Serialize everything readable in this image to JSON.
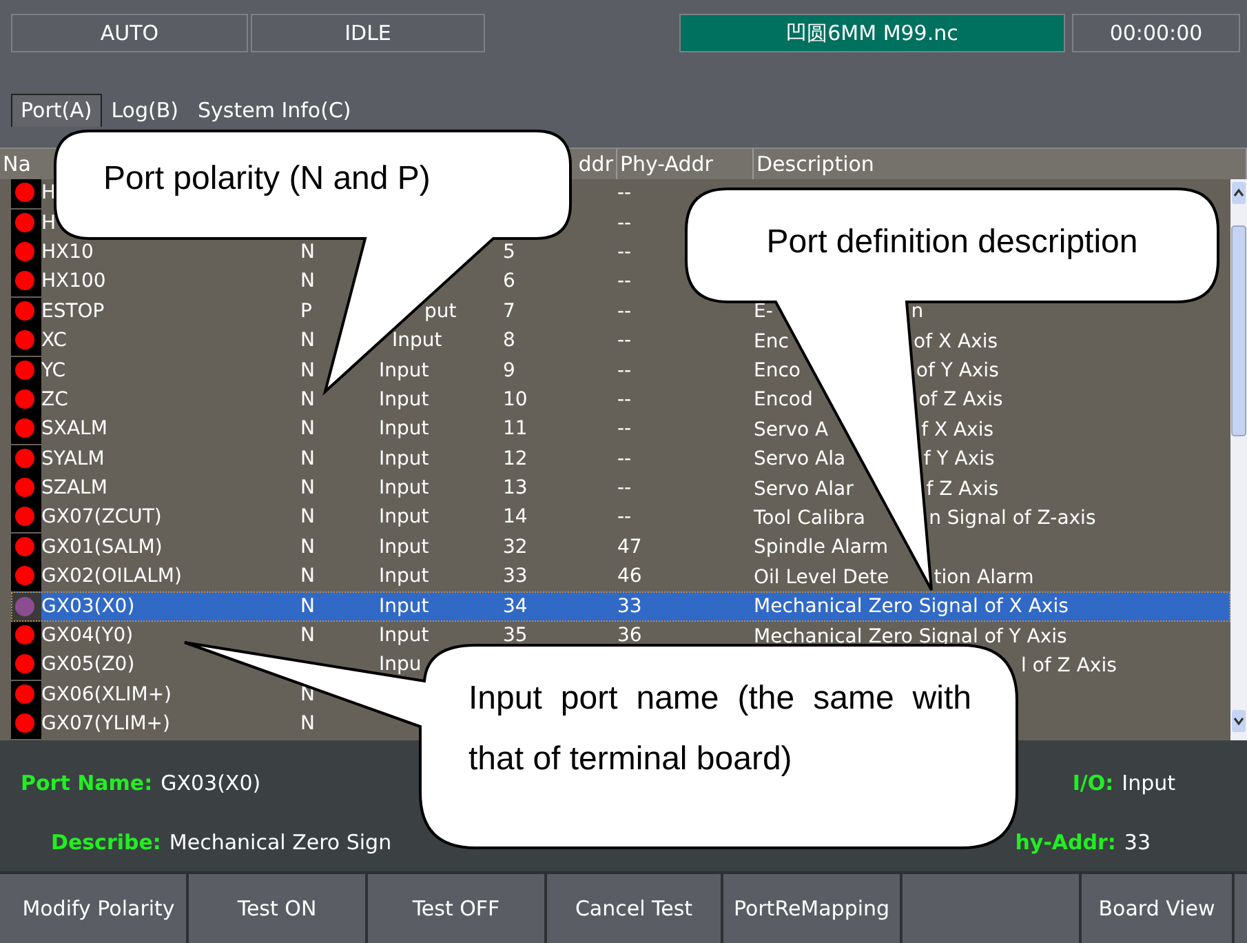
{
  "status_bar": [
    {
      "text": "AUTO",
      "highlight": false
    },
    {
      "text": "IDLE",
      "highlight": false
    },
    {
      "text": "凹圆6MM M99.nc",
      "highlight": true
    },
    {
      "text": "00:00:00",
      "highlight": false
    }
  ],
  "tabs": [
    {
      "label": "Port(A)",
      "selected": true
    },
    {
      "label": "Log(B)",
      "selected": false
    },
    {
      "label": "System Info(C)",
      "selected": false
    }
  ],
  "table": {
    "columns": [
      {
        "label": "Na",
        "kind": "name"
      },
      {
        "label": "ddr",
        "kind": "addr"
      },
      {
        "label": "Phy-Addr",
        "kind": "phy"
      },
      {
        "label": "Description",
        "kind": "desc"
      }
    ],
    "rows": [
      {
        "name": "H",
        "phy": "--",
        "selected": false
      },
      {
        "name": "H",
        "phy": "--",
        "selected": false
      },
      {
        "name": "HX10",
        "polarity": "N",
        "addr": "5",
        "phy": "--",
        "selected": false
      },
      {
        "name": "HX100",
        "polarity": "N",
        "addr": "6",
        "phy": "--",
        "selected": false
      },
      {
        "name": "ESTOP",
        "polarity": "P",
        "io": "put",
        "addr": "7",
        "phy": "--",
        "description": [
          "E-",
          "n"
        ],
        "selected": false
      },
      {
        "name": "XC",
        "polarity": "N",
        "io": "Input",
        "addr": "8",
        "phy": "--",
        "description": [
          "Enc",
          "of X Axis"
        ],
        "selected": false
      },
      {
        "name": "YC",
        "polarity": "N",
        "io": "Input",
        "addr": "9",
        "phy": "--",
        "description": [
          "Enco",
          "of Y Axis"
        ],
        "selected": false
      },
      {
        "name": "ZC",
        "polarity": "N",
        "io": "Input",
        "addr": "10",
        "phy": "--",
        "description": [
          "Encod",
          "of Z Axis"
        ],
        "selected": false
      },
      {
        "name": "SXALM",
        "polarity": "N",
        "io": "Input",
        "addr": "11",
        "phy": "--",
        "description": [
          "Servo A",
          "f X Axis"
        ],
        "selected": false
      },
      {
        "name": "SYALM",
        "polarity": "N",
        "io": "Input",
        "addr": "12",
        "phy": "--",
        "description": [
          "Servo Ala",
          "f Y Axis"
        ],
        "selected": false
      },
      {
        "name": "SZALM",
        "polarity": "N",
        "io": "Input",
        "addr": "13",
        "phy": "--",
        "description": [
          "Servo Alar",
          "f Z Axis"
        ],
        "selected": false
      },
      {
        "name": "GX07(ZCUT)",
        "polarity": "N",
        "io": "Input",
        "addr": "14",
        "phy": "--",
        "description": [
          "Tool Calibra",
          "n Signal of Z-axis"
        ],
        "selected": false
      },
      {
        "name": "GX01(SALM)",
        "polarity": "N",
        "io": "Input",
        "addr": "32",
        "phy": "47",
        "description": [
          "Spindle Alarm"
        ],
        "selected": false
      },
      {
        "name": "GX02(OILALM)",
        "polarity": "N",
        "io": "Input",
        "addr": "33",
        "phy": "46",
        "description": [
          "Oil Level Dete",
          "tion Alarm"
        ],
        "selected": false
      },
      {
        "name": "GX03(X0)",
        "polarity": "N",
        "io": "Input",
        "addr": "34",
        "phy": "33",
        "description": [
          "Mechanical Zero Signal of X Axis"
        ],
        "selected": true
      },
      {
        "name": "GX04(Y0)",
        "polarity": "N",
        "io": "Input",
        "addr": "35",
        "phy": "36",
        "description": [
          "Mechanical Zero Signal of Y Axis"
        ],
        "selected": false
      },
      {
        "name": "GX05(Z0)",
        "io": "Inpu",
        "description": [
          "l of Z Axis"
        ],
        "selected": false
      },
      {
        "name": "GX06(XLIM+)",
        "polarity": "N",
        "selected": false
      },
      {
        "name": "GX07(YLIM+)",
        "polarity": "N",
        "selected": false
      }
    ]
  },
  "port_info": {
    "port_name_label": "Port Name:",
    "port_name": "GX03(X0)",
    "io_label": "I/O:",
    "io": "Input",
    "describe_label": "Describe:",
    "describe": "Mechanical Zero Sign",
    "phy_addr_label": "hy-Addr:",
    "phy_addr": "33"
  },
  "buttons": [
    {
      "kind": "text",
      "label": "Modify Polarity"
    },
    {
      "kind": "text",
      "label": "Test ON"
    },
    {
      "kind": "text",
      "label": "Test OFF"
    },
    {
      "kind": "text",
      "label": "Cancel Test"
    },
    {
      "kind": "text",
      "label": "PortReMapping"
    },
    {
      "kind": "blank"
    },
    {
      "kind": "text",
      "label": "Board View"
    }
  ],
  "callouts": [
    {
      "text": "Port polarity (N and P)"
    },
    {
      "text": "Port definition description"
    },
    {
      "text": "Input port name (the same with that of terminal board)"
    }
  ]
}
